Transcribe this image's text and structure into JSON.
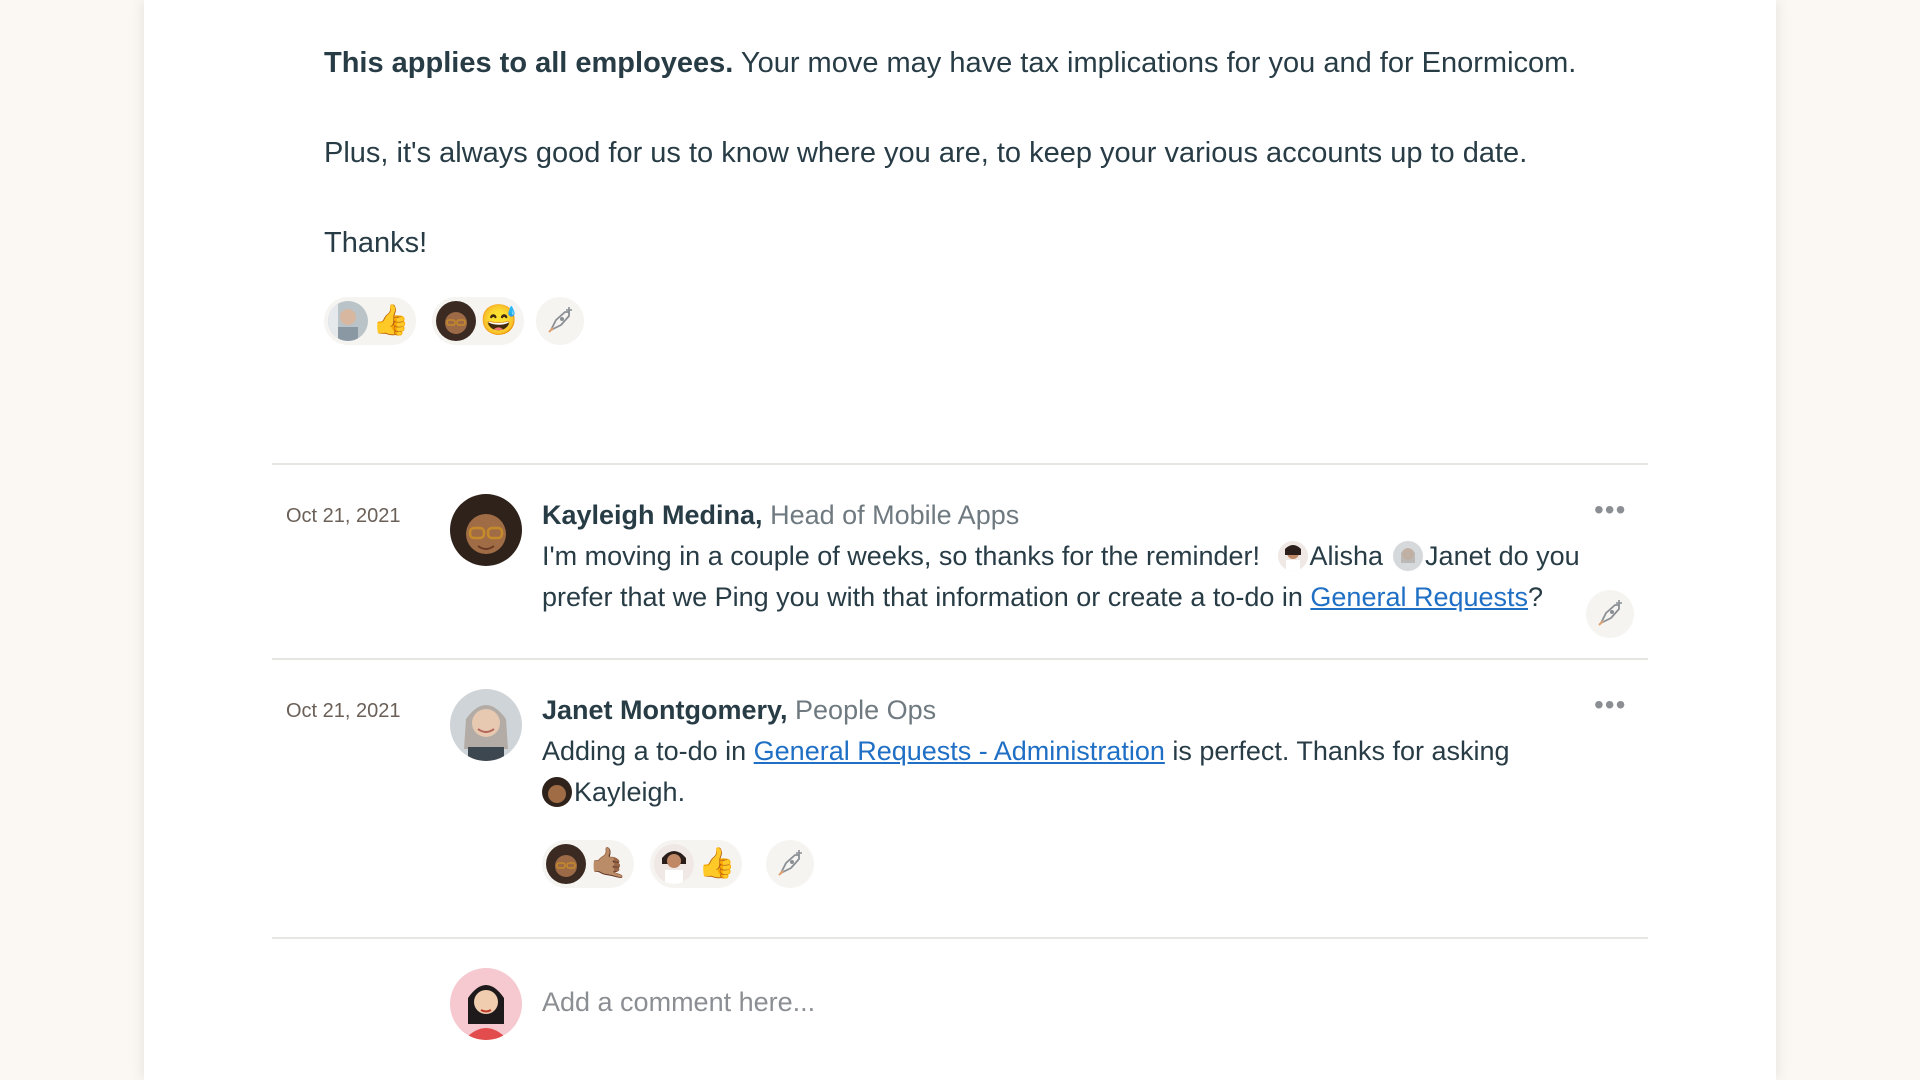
{
  "message": {
    "bold_lead": "This applies to all employees.",
    "line1_rest": " Your move may have tax implications for you and for Enormicom.",
    "line2": "Plus, it's always good for us to know where you are, to keep your various accounts up to date.",
    "line3": "Thanks!",
    "reactions": [
      {
        "emoji": "👍",
        "avatar": "man-avatar"
      },
      {
        "emoji": "😅",
        "avatar": "kayleigh-avatar"
      }
    ]
  },
  "comments": [
    {
      "date": "Oct 21, 2021",
      "name": "Kayleigh Medina,",
      "role": " Head of Mobile Apps",
      "t1": "I'm moving in a couple of weeks, so thanks for the reminder! ",
      "mention1": "Alisha",
      "mention2": "Janet",
      "t2": " do you prefer that we Ping you with that information or create a to-do in ",
      "link": "General Requests",
      "t3": "?",
      "more": "•••"
    },
    {
      "date": "Oct 21, 2021",
      "name": "Janet Montgomery,",
      "role": " People Ops",
      "t1": "Adding a to-do in ",
      "link": "General Requests - Administration",
      "t2": " is perfect. Thanks for asking",
      "mention": "Kayleigh.",
      "more": "•••",
      "reactions": [
        {
          "emoji": "🤙🏽",
          "avatar": "kayleigh-avatar"
        },
        {
          "emoji": "👍",
          "avatar": "alisha-avatar"
        }
      ]
    }
  ],
  "composer": {
    "placeholder": "Add a comment here..."
  }
}
